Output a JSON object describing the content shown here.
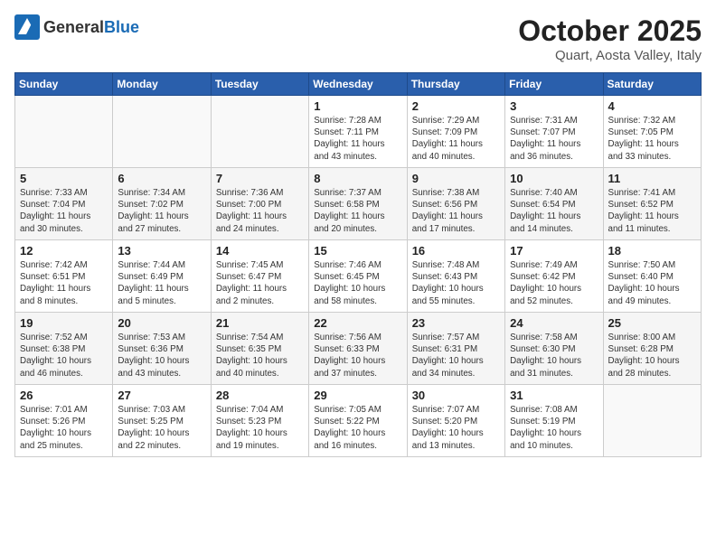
{
  "logo": {
    "text_general": "General",
    "text_blue": "Blue"
  },
  "header": {
    "month": "October 2025",
    "location": "Quart, Aosta Valley, Italy"
  },
  "weekdays": [
    "Sunday",
    "Monday",
    "Tuesday",
    "Wednesday",
    "Thursday",
    "Friday",
    "Saturday"
  ],
  "weeks": [
    [
      {
        "day": "",
        "info": ""
      },
      {
        "day": "",
        "info": ""
      },
      {
        "day": "",
        "info": ""
      },
      {
        "day": "1",
        "info": "Sunrise: 7:28 AM\nSunset: 7:11 PM\nDaylight: 11 hours\nand 43 minutes."
      },
      {
        "day": "2",
        "info": "Sunrise: 7:29 AM\nSunset: 7:09 PM\nDaylight: 11 hours\nand 40 minutes."
      },
      {
        "day": "3",
        "info": "Sunrise: 7:31 AM\nSunset: 7:07 PM\nDaylight: 11 hours\nand 36 minutes."
      },
      {
        "day": "4",
        "info": "Sunrise: 7:32 AM\nSunset: 7:05 PM\nDaylight: 11 hours\nand 33 minutes."
      }
    ],
    [
      {
        "day": "5",
        "info": "Sunrise: 7:33 AM\nSunset: 7:04 PM\nDaylight: 11 hours\nand 30 minutes."
      },
      {
        "day": "6",
        "info": "Sunrise: 7:34 AM\nSunset: 7:02 PM\nDaylight: 11 hours\nand 27 minutes."
      },
      {
        "day": "7",
        "info": "Sunrise: 7:36 AM\nSunset: 7:00 PM\nDaylight: 11 hours\nand 24 minutes."
      },
      {
        "day": "8",
        "info": "Sunrise: 7:37 AM\nSunset: 6:58 PM\nDaylight: 11 hours\nand 20 minutes."
      },
      {
        "day": "9",
        "info": "Sunrise: 7:38 AM\nSunset: 6:56 PM\nDaylight: 11 hours\nand 17 minutes."
      },
      {
        "day": "10",
        "info": "Sunrise: 7:40 AM\nSunset: 6:54 PM\nDaylight: 11 hours\nand 14 minutes."
      },
      {
        "day": "11",
        "info": "Sunrise: 7:41 AM\nSunset: 6:52 PM\nDaylight: 11 hours\nand 11 minutes."
      }
    ],
    [
      {
        "day": "12",
        "info": "Sunrise: 7:42 AM\nSunset: 6:51 PM\nDaylight: 11 hours\nand 8 minutes."
      },
      {
        "day": "13",
        "info": "Sunrise: 7:44 AM\nSunset: 6:49 PM\nDaylight: 11 hours\nand 5 minutes."
      },
      {
        "day": "14",
        "info": "Sunrise: 7:45 AM\nSunset: 6:47 PM\nDaylight: 11 hours\nand 2 minutes."
      },
      {
        "day": "15",
        "info": "Sunrise: 7:46 AM\nSunset: 6:45 PM\nDaylight: 10 hours\nand 58 minutes."
      },
      {
        "day": "16",
        "info": "Sunrise: 7:48 AM\nSunset: 6:43 PM\nDaylight: 10 hours\nand 55 minutes."
      },
      {
        "day": "17",
        "info": "Sunrise: 7:49 AM\nSunset: 6:42 PM\nDaylight: 10 hours\nand 52 minutes."
      },
      {
        "day": "18",
        "info": "Sunrise: 7:50 AM\nSunset: 6:40 PM\nDaylight: 10 hours\nand 49 minutes."
      }
    ],
    [
      {
        "day": "19",
        "info": "Sunrise: 7:52 AM\nSunset: 6:38 PM\nDaylight: 10 hours\nand 46 minutes."
      },
      {
        "day": "20",
        "info": "Sunrise: 7:53 AM\nSunset: 6:36 PM\nDaylight: 10 hours\nand 43 minutes."
      },
      {
        "day": "21",
        "info": "Sunrise: 7:54 AM\nSunset: 6:35 PM\nDaylight: 10 hours\nand 40 minutes."
      },
      {
        "day": "22",
        "info": "Sunrise: 7:56 AM\nSunset: 6:33 PM\nDaylight: 10 hours\nand 37 minutes."
      },
      {
        "day": "23",
        "info": "Sunrise: 7:57 AM\nSunset: 6:31 PM\nDaylight: 10 hours\nand 34 minutes."
      },
      {
        "day": "24",
        "info": "Sunrise: 7:58 AM\nSunset: 6:30 PM\nDaylight: 10 hours\nand 31 minutes."
      },
      {
        "day": "25",
        "info": "Sunrise: 8:00 AM\nSunset: 6:28 PM\nDaylight: 10 hours\nand 28 minutes."
      }
    ],
    [
      {
        "day": "26",
        "info": "Sunrise: 7:01 AM\nSunset: 5:26 PM\nDaylight: 10 hours\nand 25 minutes."
      },
      {
        "day": "27",
        "info": "Sunrise: 7:03 AM\nSunset: 5:25 PM\nDaylight: 10 hours\nand 22 minutes."
      },
      {
        "day": "28",
        "info": "Sunrise: 7:04 AM\nSunset: 5:23 PM\nDaylight: 10 hours\nand 19 minutes."
      },
      {
        "day": "29",
        "info": "Sunrise: 7:05 AM\nSunset: 5:22 PM\nDaylight: 10 hours\nand 16 minutes."
      },
      {
        "day": "30",
        "info": "Sunrise: 7:07 AM\nSunset: 5:20 PM\nDaylight: 10 hours\nand 13 minutes."
      },
      {
        "day": "31",
        "info": "Sunrise: 7:08 AM\nSunset: 5:19 PM\nDaylight: 10 hours\nand 10 minutes."
      },
      {
        "day": "",
        "info": ""
      }
    ]
  ]
}
